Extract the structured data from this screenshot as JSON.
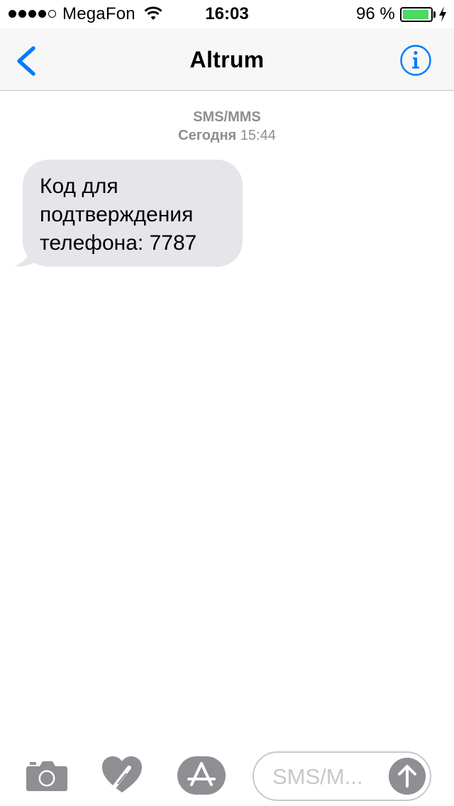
{
  "status_bar": {
    "carrier": "MegaFon",
    "time": "16:03",
    "battery_percent": "96 %",
    "battery_level": 0.96,
    "signal_bars_filled": 4,
    "signal_bars_total": 5,
    "battery_color": "#4cd964"
  },
  "nav": {
    "title": "Altrum",
    "back_icon": "chevron-left-icon",
    "info_icon": "info-icon",
    "accent_color": "#007aff"
  },
  "conversation": {
    "service_label": "SMS/MMS",
    "date_day": "Сегодня",
    "date_time": "15:44",
    "messages": [
      {
        "direction": "incoming",
        "lines": [
          "Код для",
          "подтверждения",
          "телефона: 7787"
        ]
      }
    ]
  },
  "toolbar": {
    "camera_icon": "camera-icon",
    "digital_touch_icon": "heart-icon",
    "app_store_icon": "app-store-icon",
    "input_placeholder": "SMS/M...",
    "send_icon": "arrow-up-icon"
  }
}
